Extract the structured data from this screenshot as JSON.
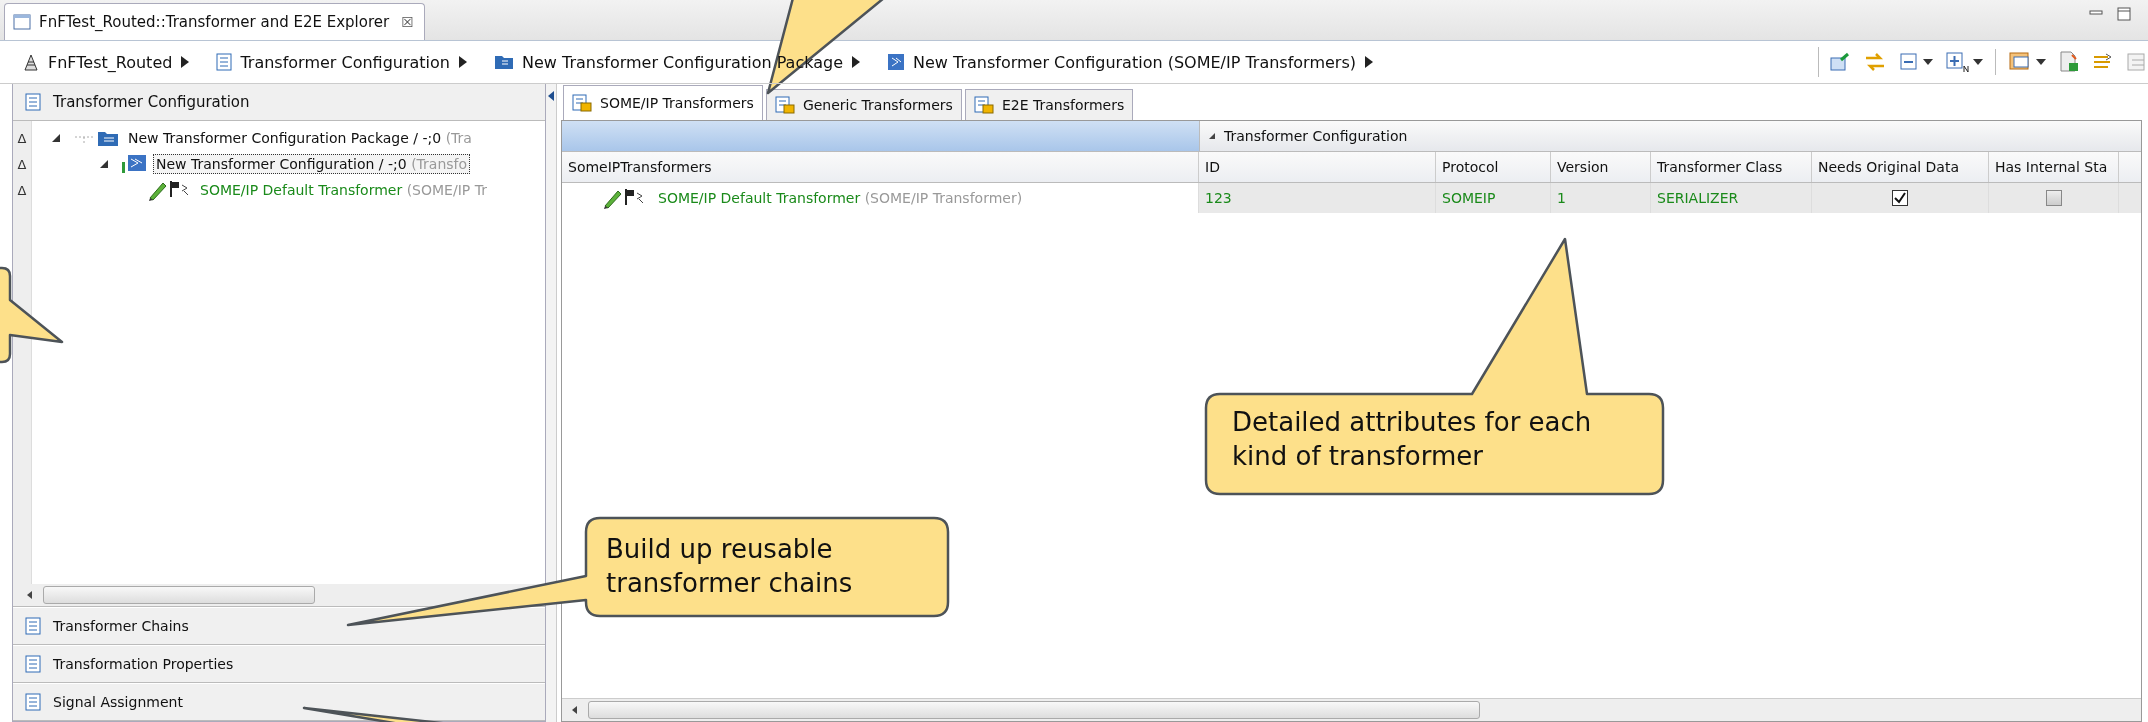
{
  "editor_tab": {
    "title": "FnFTest_Routed::Transformer and E2E Explorer",
    "close": "☒"
  },
  "breadcrumb": [
    {
      "label": "FnFTest_Routed",
      "kind": "project"
    },
    {
      "label": "Transformer Configuration",
      "kind": "config"
    },
    {
      "label": "New Transformer Configuration Package",
      "kind": "package"
    },
    {
      "label": "New Transformer Configuration (SOME/IP Transformers)",
      "kind": "transformers"
    }
  ],
  "left_panel": {
    "title": "Transformer Configuration",
    "tree": [
      {
        "gutter": "Δ",
        "name": "New Transformer Configuration Package / -;0",
        "hint": "(Tra",
        "kind": "package",
        "expanded": true,
        "selected": false,
        "children": [
          {
            "gutter": "Δ",
            "name": "New Transformer Configuration / -;0",
            "hint": "(Transfo",
            "kind": "configuration",
            "expanded": true,
            "selected": true,
            "children": [
              {
                "gutter": "Δ",
                "name": "SOME/IP Default Transformer",
                "hint": "(SOME/IP Tr",
                "kind": "transformer",
                "selected": false
              }
            ]
          }
        ]
      }
    ],
    "sections": [
      "Transformer Chains",
      "Transformation Properties",
      "Signal Assignment"
    ]
  },
  "tabs": [
    {
      "label": "SOME/IP Transformers",
      "selected": true
    },
    {
      "label": "Generic Transformers",
      "selected": false
    },
    {
      "label": "E2E Transformers",
      "selected": false
    }
  ],
  "table": {
    "group": "Transformer Configuration",
    "columns": [
      "SomeIPTransformers",
      "ID",
      "Protocol",
      "Version",
      "Transformer Class",
      "Needs Original Data",
      "Has Internal Sta"
    ],
    "rows": [
      {
        "cells": [
          {
            "kind": "name",
            "text": "SOME/IP Default Transformer",
            "hint": "(SOME/IP Transformer)"
          },
          {
            "kind": "text",
            "text": "123"
          },
          {
            "kind": "text",
            "text": "SOMEIP"
          },
          {
            "kind": "text",
            "text": "1"
          },
          {
            "kind": "text",
            "text": "SERIALIZER"
          },
          {
            "kind": "check",
            "checked": true
          },
          {
            "kind": "check",
            "checked": false
          }
        ]
      }
    ]
  },
  "callouts": [
    {
      "text": "Build up reusable transformer chains"
    },
    {
      "text": "Detailed attributes for each kind of transformer"
    }
  ]
}
